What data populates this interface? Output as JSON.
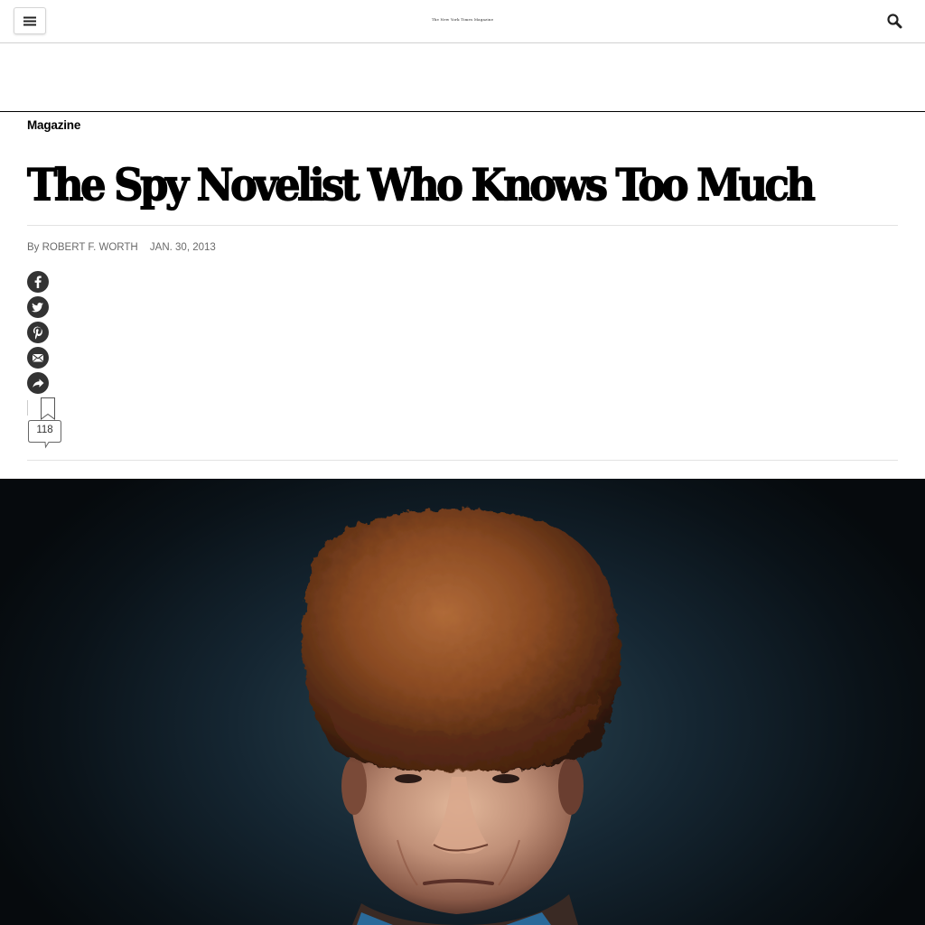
{
  "header": {
    "menu_icon": "hamburger-menu-icon",
    "logo_text": "The New York Times Magazine",
    "search_icon": "search-icon"
  },
  "article": {
    "section": "Magazine",
    "headline": "The Spy Novelist Who Knows Too Much",
    "byline_prefix": "By",
    "author": "ROBERT F. WORTH",
    "date": "JAN. 30, 2013"
  },
  "share": {
    "items": [
      {
        "name": "facebook",
        "icon": "facebook-icon"
      },
      {
        "name": "twitter",
        "icon": "twitter-icon"
      },
      {
        "name": "pinterest",
        "icon": "pinterest-icon"
      },
      {
        "name": "email",
        "icon": "email-icon"
      },
      {
        "name": "more",
        "icon": "share-arrow-icon"
      }
    ],
    "save_icon": "bookmark-icon",
    "comment_count": "118"
  },
  "hero_image": {
    "subject": "portrait-man-fur-hat",
    "colors": {
      "background": "#0a1218",
      "hat": "#8a4a22",
      "skin": "#c09078",
      "shirt": "#2a6a9a"
    }
  }
}
